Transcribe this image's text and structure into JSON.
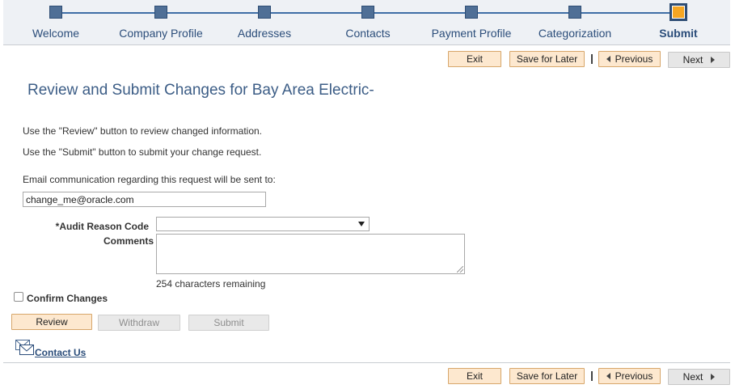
{
  "train": {
    "steps": [
      {
        "label": "Welcome"
      },
      {
        "label": "Company Profile"
      },
      {
        "label": "Addresses"
      },
      {
        "label": "Contacts"
      },
      {
        "label": "Payment Profile"
      },
      {
        "label": "Categorization"
      },
      {
        "label": "Submit",
        "active": true
      }
    ]
  },
  "toolbar": {
    "exit_label": "Exit",
    "save_label": "Save for Later",
    "previous_label": "Previous",
    "next_label": "Next"
  },
  "page": {
    "title": "Review and Submit Changes for Bay Area Electric-",
    "instruction_review": "Use the \"Review\" button to review changed information.",
    "instruction_submit": "Use the \"Submit\" button to submit your change request.",
    "email_prompt": "Email communication regarding this request will be sent to:",
    "email_value": "change_me@oracle.com",
    "audit_reason_label": "*Audit Reason Code",
    "audit_reason_value": "",
    "comments_label": "Comments",
    "chars_remaining": "254 characters remaining",
    "confirm_label": "Confirm Changes",
    "confirm_checked": false
  },
  "actions": {
    "review_label": "Review",
    "withdraw_label": "Withdraw",
    "submit_label": "Submit"
  },
  "footer": {
    "contact_label": "Contact Us"
  },
  "colors": {
    "accent": "#3c5d86",
    "active_step": "#f5a623",
    "orange_button": "#fde8cf"
  }
}
